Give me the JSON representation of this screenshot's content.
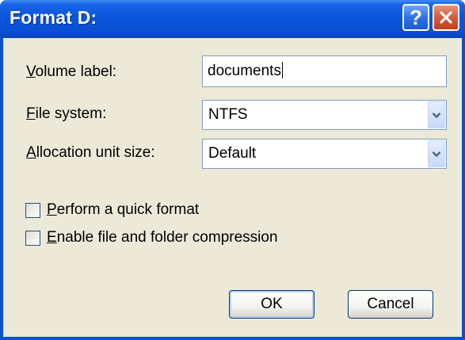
{
  "window": {
    "title": "Format D:"
  },
  "titlebar": {
    "help_label": "?",
    "close_icon": "close-icon",
    "help_icon": "help-icon"
  },
  "form": {
    "volume_label": {
      "label_accel": "V",
      "label_rest": "olume label:",
      "value": "documents"
    },
    "file_system": {
      "label_accel": "F",
      "label_rest": "ile system:",
      "value": "NTFS"
    },
    "allocation_unit_size": {
      "label_accel": "A",
      "label_rest": "llocation unit size:",
      "value": "Default"
    }
  },
  "options": {
    "quick_format": {
      "label_accel": "P",
      "label_rest": "erform a quick format",
      "checked": false
    },
    "compression": {
      "label_accel": "E",
      "label_rest": "nable file and folder compression",
      "checked": false
    }
  },
  "buttons": {
    "ok": "OK",
    "cancel": "Cancel"
  },
  "colors": {
    "titlebar": "#0a55dd",
    "client": "#ece9d8",
    "close_button": "#d65a3c",
    "input_border": "#7f9db9"
  }
}
